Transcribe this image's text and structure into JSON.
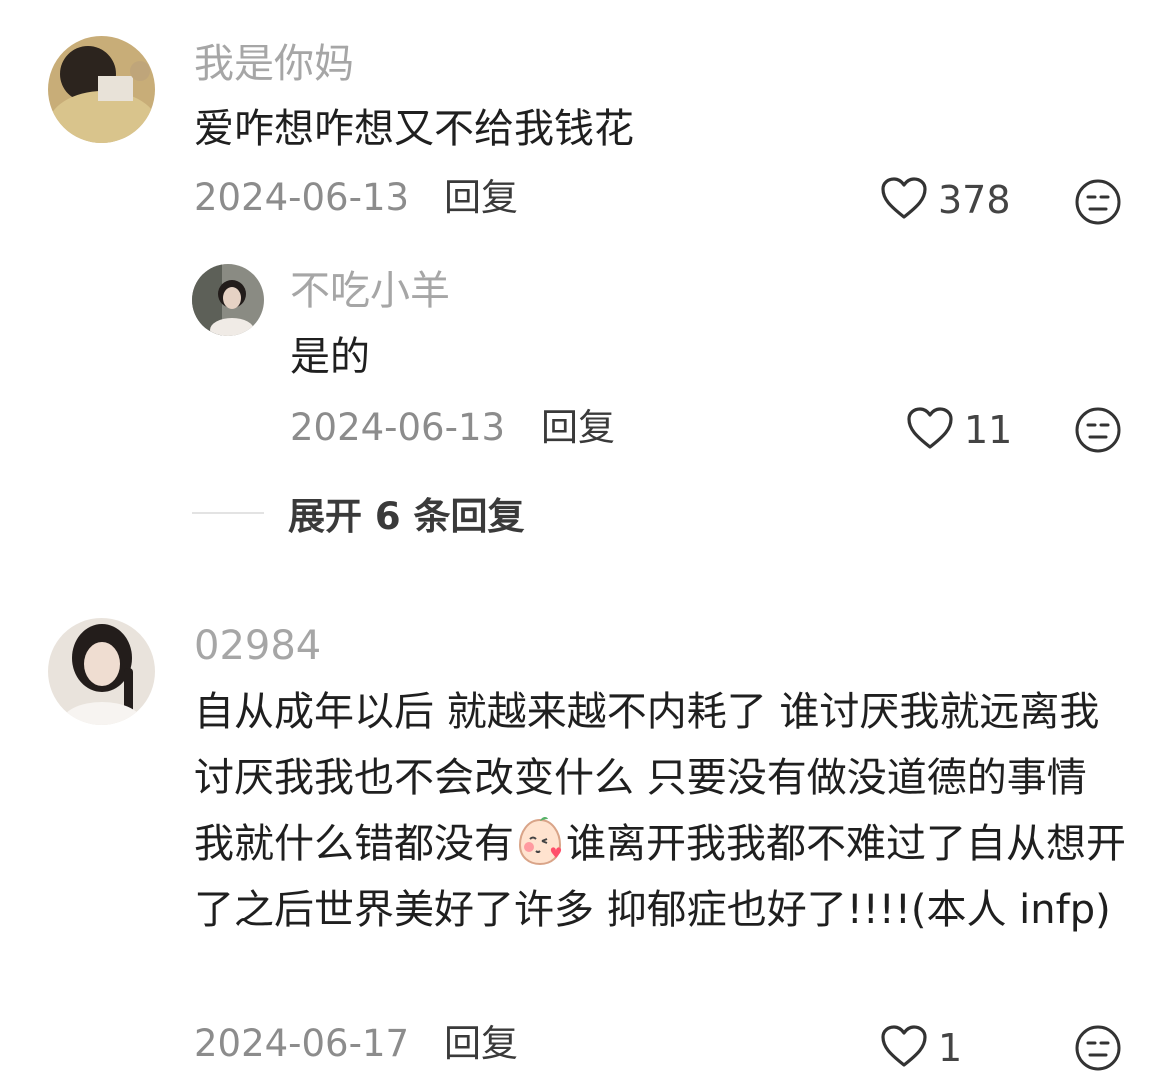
{
  "comments": [
    {
      "username": "我是你妈",
      "text": "爱咋想咋想又不给我钱花",
      "date": "2024-06-13",
      "reply_label": "回复",
      "likes": "378",
      "replies": [
        {
          "username": "不吃小羊",
          "text": "是的",
          "date": "2024-06-13",
          "reply_label": "回复",
          "likes": "11"
        }
      ],
      "expand_label": "展开 6 条回复"
    },
    {
      "username": "02984",
      "text_before_emoji": "自从成年以后 就越来越不内耗了 谁讨厌我就远离我 讨厌我我也不会改变什么 只要没有做没道德的事情 我就什么错都没有",
      "text_after_emoji": "谁离开我我都不难过了自从想开了之后世界美好了许多 抑郁症也好了!!!!(本人 infp)",
      "date": "2024-06-17",
      "reply_label": "回复",
      "likes": "1"
    }
  ],
  "icons": {
    "like": "heart-outline-icon",
    "dislike": "neutral-face-icon",
    "emoji": "blushing-face-emoji"
  },
  "colors": {
    "username": "#a6a6a6",
    "text": "#1f1f1f",
    "meta": "#8c8c8c"
  }
}
